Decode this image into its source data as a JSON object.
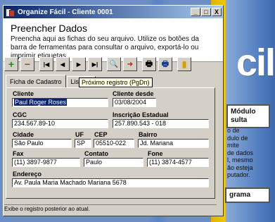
{
  "window": {
    "title": "Organize Fácil - Cliente 0001",
    "controls": [
      "_",
      "□",
      "X"
    ]
  },
  "header": {
    "title": "Preencher Dados",
    "description": "Preencha aqui as fichas do seu arquivo. Utilize os botões da barra de ferramentas para consultar o arquivo, exportá-lo ou imprimir etiquetas."
  },
  "toolbar": {
    "buttons": [
      {
        "name": "add",
        "glyph": "+",
        "color": "#1a8a1a"
      },
      {
        "name": "delete",
        "glyph": "−",
        "color": "#c0392b"
      },
      {
        "name": "first",
        "glyph": "|◀"
      },
      {
        "name": "previous",
        "glyph": "◀"
      },
      {
        "name": "next",
        "glyph": "▶"
      },
      {
        "name": "last",
        "glyph": "▶|"
      },
      {
        "name": "search",
        "glyph": "🔍"
      },
      {
        "name": "export",
        "glyph": "➜"
      },
      {
        "name": "print",
        "glyph": "🖶"
      },
      {
        "name": "print-labels",
        "glyph": "🖶"
      },
      {
        "name": "exit",
        "glyph": "▮"
      }
    ]
  },
  "tabs": [
    "Ficha de Cadastro",
    "Listage"
  ],
  "tooltip": "Próximo registro (PgDn)",
  "form": {
    "cliente_label": "Cliente",
    "cliente_value": "Paul Roger Roses",
    "cliente_desde_label": "Cliente desde",
    "cliente_desde_value": "03/08/2004",
    "cgc_label": "CGC",
    "cgc_value": "234.567.89-10",
    "inscricao_label": "Inscrição Estadual",
    "inscricao_value": "257.890.543 - 018",
    "cidade_label": "Cidade",
    "cidade_value": "São Paulo",
    "uf_label": "UF",
    "uf_value": "SP",
    "cep_label": "CEP",
    "cep_value": "05510-022",
    "bairro_label": "Bairro",
    "bairro_value": "Jd. Mariana",
    "fax_label": "Fax",
    "fax_value": "(11) 3897-9877",
    "contato_label": "Contato",
    "contato_value": "Paulo",
    "fone_label": "Fone",
    "fone_value": "(11) 3874-4577",
    "endereco_label": "Endereço",
    "endereco_value": "Av. Paula Maria Machado Mariana  5678"
  },
  "status_text": "Exibe o registro posterior ao atual.",
  "background_app": {
    "big_text": "cil",
    "button1_line1": "Módulo",
    "button1_line2": "sulta",
    "body_lines": [
      "o de",
      "dulo de",
      "mite",
      "de dados",
      "l, mesmo",
      "ão esteja",
      "putador."
    ],
    "button2": "grama"
  }
}
